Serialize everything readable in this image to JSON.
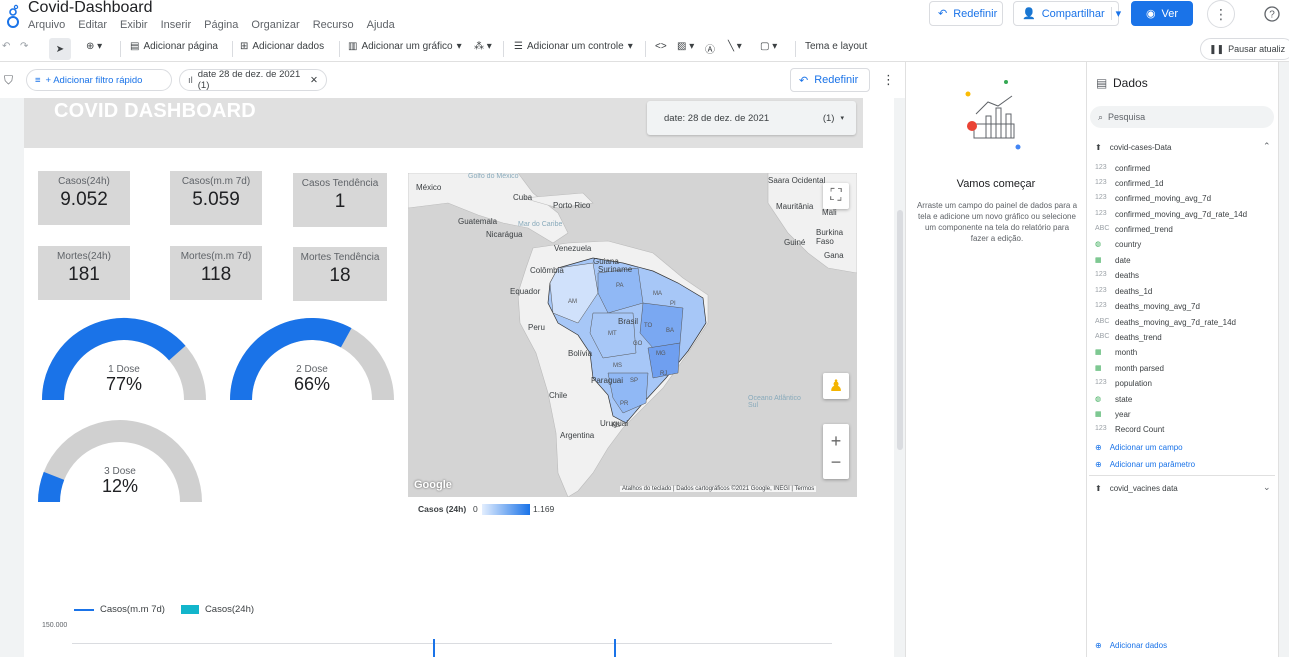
{
  "app": {
    "title": "Covid-Dashboard",
    "menu": [
      "Arquivo",
      "Editar",
      "Exibir",
      "Inserir",
      "Página",
      "Organizar",
      "Recurso",
      "Ajuda"
    ],
    "reset_label": "Redefinir",
    "share_label": "Compartilhar",
    "view_label": "Ver"
  },
  "toolbar": {
    "add_page": "Adicionar página",
    "add_data": "Adicionar dados",
    "add_chart": "Adicionar um gráfico",
    "add_control": "Adicionar um controle",
    "theme": "Tema e layout",
    "pause": "Pausar atualiz"
  },
  "filterbar": {
    "quick_filter": "+ Adicionar filtro rápido",
    "date_chip": "date 28 de dez. de 2021 (1)",
    "reset": "Redefinir"
  },
  "report": {
    "title": "COVID DASHBOARD",
    "date_control": {
      "label": "date",
      "value": "28 de dez. de 2021",
      "count": "(1)"
    },
    "kpis": [
      {
        "label": "Casos(24h)",
        "value": "9.052"
      },
      {
        "label": "Casos(m.m 7d)",
        "value": "5.059"
      },
      {
        "label": "Casos Tendência",
        "value": "1"
      },
      {
        "label": "Mortes(24h)",
        "value": "181"
      },
      {
        "label": "Mortes(m.m 7d)",
        "value": "118"
      },
      {
        "label": "Mortes Tendência",
        "value": "18"
      }
    ],
    "gauges": [
      {
        "label": "1 Dose",
        "value": "77%",
        "fraction": 0.77
      },
      {
        "label": "2 Dose",
        "value": "66%",
        "fraction": 0.66
      },
      {
        "label": "3 Dose",
        "value": "12%",
        "fraction": 0.12
      }
    ],
    "map": {
      "labels": [
        "México",
        "Cuba",
        "Porto Rico",
        "Guatemala",
        "Nicarágua",
        "Venezuela",
        "Guiana",
        "Suriname",
        "Colômbia",
        "Equador",
        "Peru",
        "Brasil",
        "Bolívia",
        "Paraguai",
        "Chile",
        "Argentina",
        "Uruguai",
        "Saara Ocidental",
        "Mauritânia",
        "Mali",
        "Burkina Faso",
        "Guiné",
        "Gana",
        "Golfo do México",
        "Mar do Caribe",
        "Oceano Atlântico Sul"
      ],
      "states": [
        "AM",
        "PA",
        "MT",
        "BA",
        "MG",
        "GO",
        "TO",
        "MA",
        "PI",
        "MS",
        "SP",
        "PR",
        "RS",
        "RJ"
      ],
      "attribution": "Atalhos do teclado  |  Dados cartográficos ©2021 Google, INEGI  |  Termos",
      "google": "Google",
      "legend_title": "Casos (24h)",
      "legend_min": "0",
      "legend_max": "1.169"
    },
    "bottom_chart": {
      "legend": [
        "Casos(m.m 7d)",
        "Casos(24h)"
      ],
      "y_tick": "150.000",
      "colors": [
        "#1a73e8",
        "#12b5cb"
      ]
    }
  },
  "mid_panel": {
    "title": "Vamos começar",
    "text": "Arraste um campo do painel de dados para a tela e adicione um novo gráfico ou selecione um componente na tela do relatório para fazer a edição."
  },
  "data_panel": {
    "title": "Dados",
    "search_placeholder": "Pesquisa",
    "source_1": "covid-cases-Data",
    "fields": [
      {
        "type": "123",
        "name": "confirmed"
      },
      {
        "type": "123",
        "name": "confirmed_1d"
      },
      {
        "type": "123",
        "name": "confirmed_moving_avg_7d"
      },
      {
        "type": "123",
        "name": "confirmed_moving_avg_7d_rate_14d"
      },
      {
        "type": "ABC",
        "name": "confirmed_trend"
      },
      {
        "type": "globe",
        "name": "country"
      },
      {
        "type": "cal",
        "name": "date"
      },
      {
        "type": "123",
        "name": "deaths"
      },
      {
        "type": "123",
        "name": "deaths_1d"
      },
      {
        "type": "123",
        "name": "deaths_moving_avg_7d"
      },
      {
        "type": "ABC",
        "name": "deaths_moving_avg_7d_rate_14d"
      },
      {
        "type": "ABC",
        "name": "deaths_trend"
      },
      {
        "type": "cal",
        "name": "month"
      },
      {
        "type": "cal",
        "name": "month parsed"
      },
      {
        "type": "123",
        "name": "population"
      },
      {
        "type": "globe",
        "name": "state"
      },
      {
        "type": "cal",
        "name": "year"
      },
      {
        "type": "123",
        "name": "Record Count"
      }
    ],
    "add_field": "Adicionar um campo",
    "add_param": "Adicionar um parâmetro",
    "source_2": "covid_vacines data",
    "add_data": "Adicionar dados"
  },
  "colors": {
    "accent": "#1a73e8",
    "gauge_bg": "#d0d0d0",
    "kpi_bg": "#d7d7d7",
    "header_bg": "#e0e0e0"
  }
}
